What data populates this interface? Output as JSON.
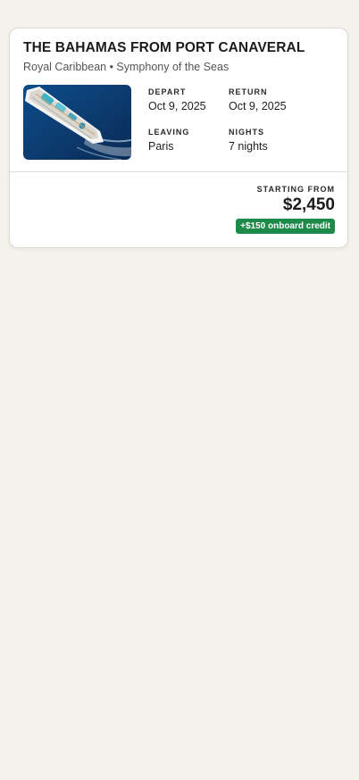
{
  "card": {
    "title": "THE BAHAMAS FROM PORT CANAVERAL",
    "subtitle": "Royal Caribbean • Symphony of the Seas",
    "details": {
      "depart": {
        "label": "DEPART",
        "value": "Oct 9, 2025"
      },
      "return": {
        "label": "RETURN",
        "value": "Oct 9, 2025"
      },
      "leaving": {
        "label": "LEAVING",
        "value": "Paris"
      },
      "nights": {
        "label": "NIGHTS",
        "value": "7 nights"
      }
    },
    "price": {
      "label": "STARTING FROM",
      "value": "$2,450",
      "credit": "+$150 onboard credit"
    }
  },
  "colors": {
    "page_background": "#f5f2eb",
    "card_background": "#ffffff",
    "credit_badge": "#1e8a4a",
    "ocean": "#0f3f73"
  },
  "icons": {
    "ship_image": "cruise-ship-aerial-photo"
  }
}
